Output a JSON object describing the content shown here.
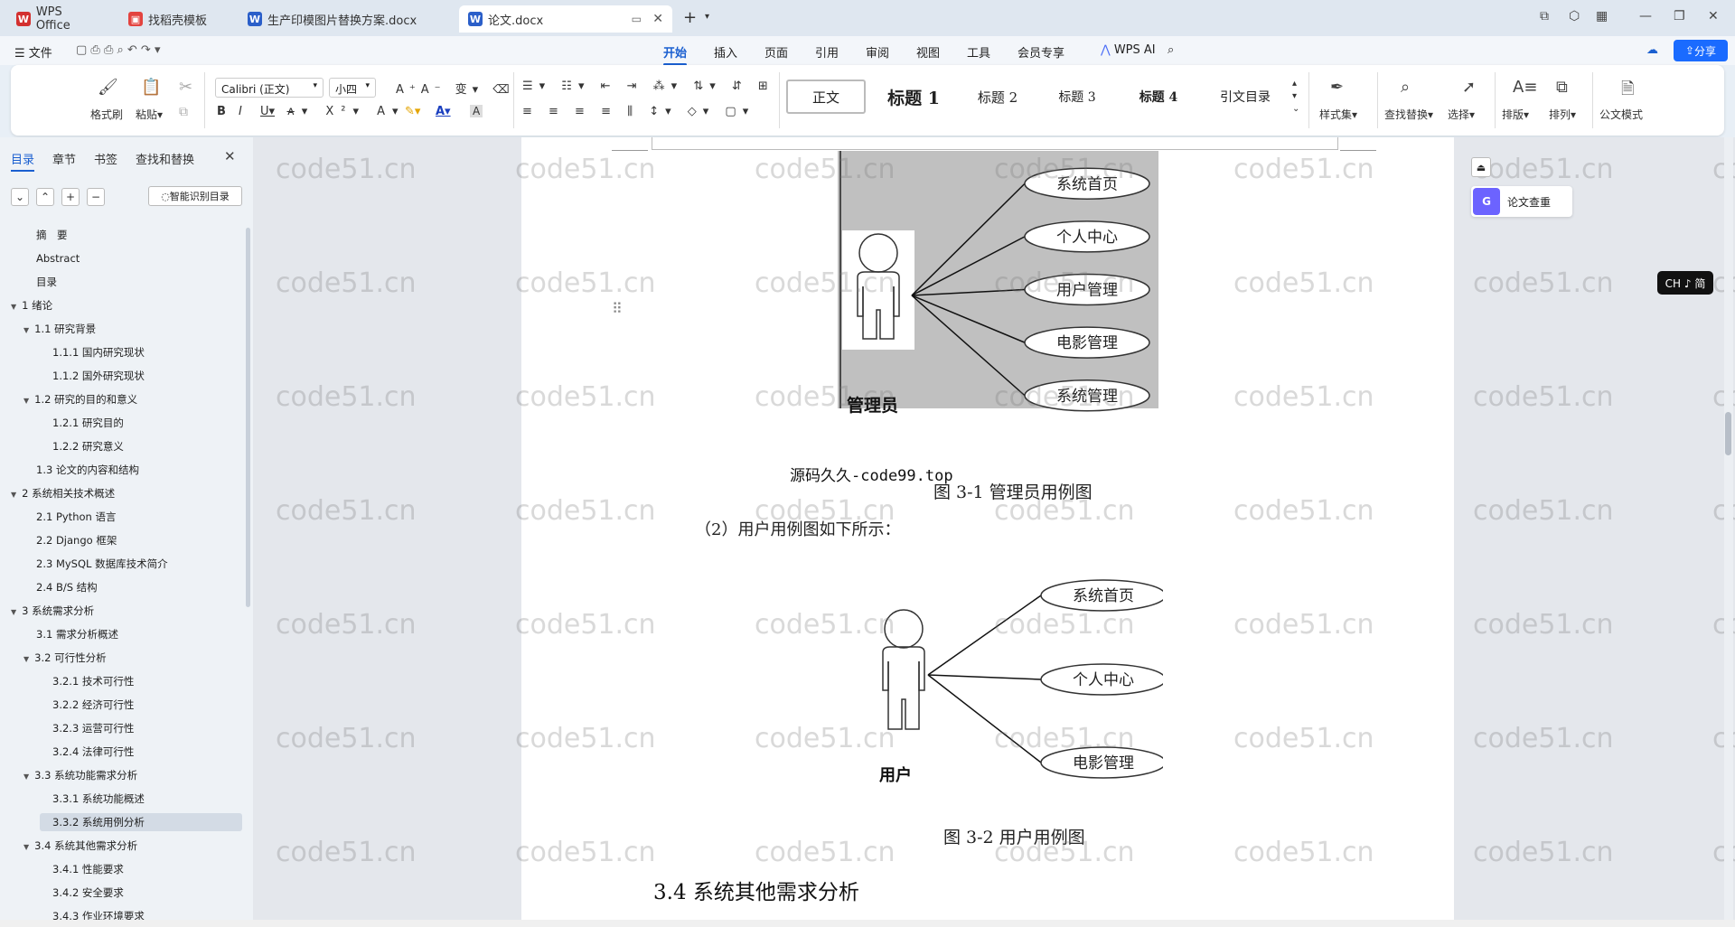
{
  "titlebar": {
    "tabs": [
      {
        "label": "WPS Office",
        "icon": "wps-logo-icon"
      },
      {
        "label": "找稻壳模板",
        "icon": "docer-icon"
      },
      {
        "label": "生产印模图片替换方案.docx",
        "icon": "word-doc-icon"
      },
      {
        "label": "论文.docx",
        "icon": "word-doc-icon"
      }
    ],
    "new_tab": "+"
  },
  "menubar": {
    "file": "文件",
    "items": [
      "开始",
      "插入",
      "页面",
      "引用",
      "审阅",
      "视图",
      "工具",
      "会员专享"
    ],
    "active": "开始",
    "wps_ai": "WPS AI",
    "share": "分享"
  },
  "ribbon": {
    "format_brush": "格式刷",
    "paste": "粘贴",
    "font_name": "Calibri (正文)",
    "font_size": "小四",
    "styles": [
      "正文",
      "标题 1",
      "标题 2",
      "标题 3",
      "标题 4",
      "引文目录"
    ],
    "style_set": "样式集",
    "find_replace": "查找替换",
    "select": "选择",
    "layout": "排版",
    "arrange": "排列",
    "official": "公文模式"
  },
  "sidebar": {
    "tabs": [
      "目录",
      "章节",
      "书签",
      "查找和替换"
    ],
    "smart_toc": "智能识别目录",
    "toc": [
      {
        "label": "摘　要",
        "level": 1,
        "tri": false
      },
      {
        "label": "Abstract",
        "level": 1,
        "tri": false
      },
      {
        "label": "目录",
        "level": 1,
        "tri": false
      },
      {
        "label": "1 绪论",
        "level": 0,
        "tri": true
      },
      {
        "label": "1.1  研究背景",
        "level": 1,
        "tri": true
      },
      {
        "label": "1.1.1 国内研究现状",
        "level": 2,
        "tri": false
      },
      {
        "label": "1.1.2 国外研究现状",
        "level": 2,
        "tri": false
      },
      {
        "label": "1.2 研究的目的和意义",
        "level": 1,
        "tri": true
      },
      {
        "label": "1.2.1 研究目的",
        "level": 2,
        "tri": false
      },
      {
        "label": "1.2.2  研究意义",
        "level": 2,
        "tri": false
      },
      {
        "label": "1.3  论文的内容和结构",
        "level": 1,
        "tri": false
      },
      {
        "label": "2 系统相关技术概述",
        "level": 0,
        "tri": true
      },
      {
        "label": "2.1 Python 语言",
        "level": 1,
        "tri": false
      },
      {
        "label": "2.2 Django 框架",
        "level": 1,
        "tri": false
      },
      {
        "label": "2.3 MySQL 数据库技术简介",
        "level": 1,
        "tri": false
      },
      {
        "label": "2.4 B/S 结构",
        "level": 1,
        "tri": false
      },
      {
        "label": "3 系统需求分析",
        "level": 0,
        "tri": true
      },
      {
        "label": "3.1 需求分析概述",
        "level": 1,
        "tri": false
      },
      {
        "label": "3.2 可行性分析",
        "level": 1,
        "tri": true
      },
      {
        "label": "3.2.1 技术可行性",
        "level": 2,
        "tri": false
      },
      {
        "label": "3.2.2 经济可行性",
        "level": 2,
        "tri": false
      },
      {
        "label": "3.2.3 运营可行性",
        "level": 2,
        "tri": false
      },
      {
        "label": "3.2.4 法律可行性",
        "level": 2,
        "tri": false
      },
      {
        "label": "3.3 系统功能需求分析",
        "level": 1,
        "tri": true
      },
      {
        "label": "3.3.1 系统功能概述",
        "level": 2,
        "tri": false
      },
      {
        "label": "3.3.2 系统用例分析",
        "level": 2,
        "tri": false,
        "selected": true
      },
      {
        "label": "3.4 系统其他需求分析",
        "level": 1,
        "tri": true
      },
      {
        "label": "3.4.1 性能要求",
        "level": 2,
        "tri": false
      },
      {
        "label": "3.4.2 安全要求",
        "level": 2,
        "tri": false
      },
      {
        "label": "3.4.3 作业环境要求",
        "level": 2,
        "tri": false
      }
    ]
  },
  "document": {
    "admin_diagram": {
      "actor": "管理员",
      "cases": [
        "系统首页",
        "个人中心",
        "用户管理",
        "电影管理",
        "系统管理"
      ]
    },
    "source_mark": "源码久久-code99.top",
    "caption1": "图 3-1 管理员用例图",
    "para": "（2）用户用例图如下所示：",
    "user_diagram": {
      "actor": "用户",
      "cases": [
        "系统首页",
        "个人中心",
        "电影管理"
      ]
    },
    "caption2": "图 3-2 用户用例图",
    "heading": "3.4 系统其他需求分析"
  },
  "rightpanel": {
    "check": "论文查重",
    "ime": "CH ♪ 简"
  },
  "watermark": "code51.cn",
  "colors": {
    "accent": "#1a5fd0",
    "diagram_bg": "#c0c0c0"
  }
}
